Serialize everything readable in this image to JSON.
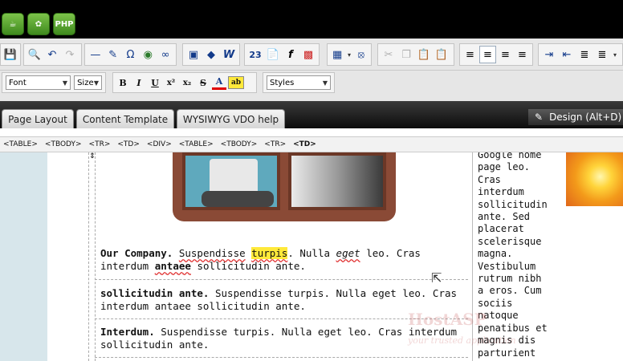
{
  "app_buttons": [
    {
      "icon": "cup-icon"
    },
    {
      "icon": "leaf-icon"
    },
    {
      "label": "PHP"
    }
  ],
  "toolbar_row1": {
    "group1": [
      "save-icon"
    ],
    "group2": [
      "find-icon",
      "undo-icon",
      "redo-icon"
    ],
    "group3": [
      "hr-icon",
      "highlight-pen-icon",
      "omega-icon",
      "globe-icon",
      "unlink-icon"
    ],
    "group4": [
      "image-icon",
      "anchor-icon",
      "word-icon"
    ],
    "group5": [
      "number-23-icon",
      "page-icon",
      "flash-icon",
      "film-icon"
    ],
    "group6": [
      "table-icon",
      "cell-select-icon"
    ],
    "group7": [
      "cut-icon",
      "copy-icon",
      "paste-icon",
      "paste-text-icon"
    ],
    "group8": [
      "align-left-icon",
      "align-center-icon",
      "align-right-icon",
      "justify-icon"
    ],
    "group9": [
      "indent-icon",
      "outdent-icon",
      "ordered-list-icon",
      "unordered-list-icon"
    ],
    "group6_glyph": "⦻"
  },
  "toolbar_row2": {
    "font_label": "Font",
    "size_label": "Size",
    "styles_label": "Styles",
    "format_buttons": [
      "B",
      "I",
      "U",
      "x²",
      "x₂",
      "S",
      "A",
      "ab"
    ]
  },
  "tabs": [
    {
      "label": "Page Layout"
    },
    {
      "label": "Content Template"
    },
    {
      "label": "WYSIWYG VDO help"
    }
  ],
  "design_button": {
    "label": "Design (Alt+D)"
  },
  "tag_path": [
    "<TABLE>",
    "<TBODY>",
    "<TR>",
    "<TD>",
    "<DIV>",
    "<TABLE>",
    "<TBODY>",
    "<TR>",
    "<TD>"
  ],
  "content": {
    "para1": {
      "bold": "Our Company.",
      "p1": "Suspendisse",
      "hl": "turpis",
      "p2": ". Nulla",
      "em": "eget",
      "p3": "leo. Cras interdum",
      "bold2": "antaee",
      "p4": "sollicitudin ante."
    },
    "para2": {
      "bold": "sollicitudin ante.",
      "rest": "Suspendisse turpis. Nulla eget leo. Cras interdum antaee sollicitudin ante."
    },
    "para3": {
      "bold": "Interdum.",
      "rest": "Suspendisse turpis. Nulla eget leo. Cras interdum sollicitudin ante."
    },
    "right_column": [
      "Google home",
      "page leo.",
      "Cras",
      "interdum",
      "sollicitudin",
      "ante. Sed",
      "placerat",
      "scelerisque",
      "magna.",
      "Vestibulum",
      "rutrum nibh",
      "a eros. Cum",
      "sociis",
      "natoque",
      "penatibus et",
      "magnis dis",
      "parturient"
    ]
  },
  "watermark": {
    "brand": "HostASP",
    "tagline": "your trusted application"
  }
}
